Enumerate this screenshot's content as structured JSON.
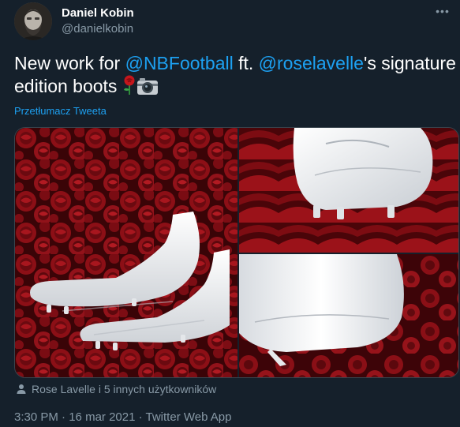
{
  "author": {
    "display_name": "Daniel Kobin",
    "handle": "@danielkobin"
  },
  "tweet": {
    "text_1": "New work for ",
    "mention_1": "@NBFootball",
    "text_2": " ft. ",
    "mention_2": "@roselavelle",
    "text_3": "'s signature edition boots",
    "translate_label": "Przetłumacz Tweeta"
  },
  "media": {
    "photo_count": 3
  },
  "engagement": {
    "liked_by": "Rose Lavelle i 5 innych użytkowników"
  },
  "meta": {
    "time": "3:30 PM",
    "separator_1": " · ",
    "date": "16 mar 2021",
    "separator_2": " · ",
    "source": "Twitter Web App"
  },
  "icons": {
    "more": "more-dots-icon",
    "person": "person-icon",
    "rose": "rose-emoji-icon",
    "camera": "camera-emoji-icon"
  },
  "colors": {
    "background": "#15202b",
    "accent": "#1da1f2",
    "secondary_text": "#8899a6",
    "rose_red": "#a3141c"
  }
}
